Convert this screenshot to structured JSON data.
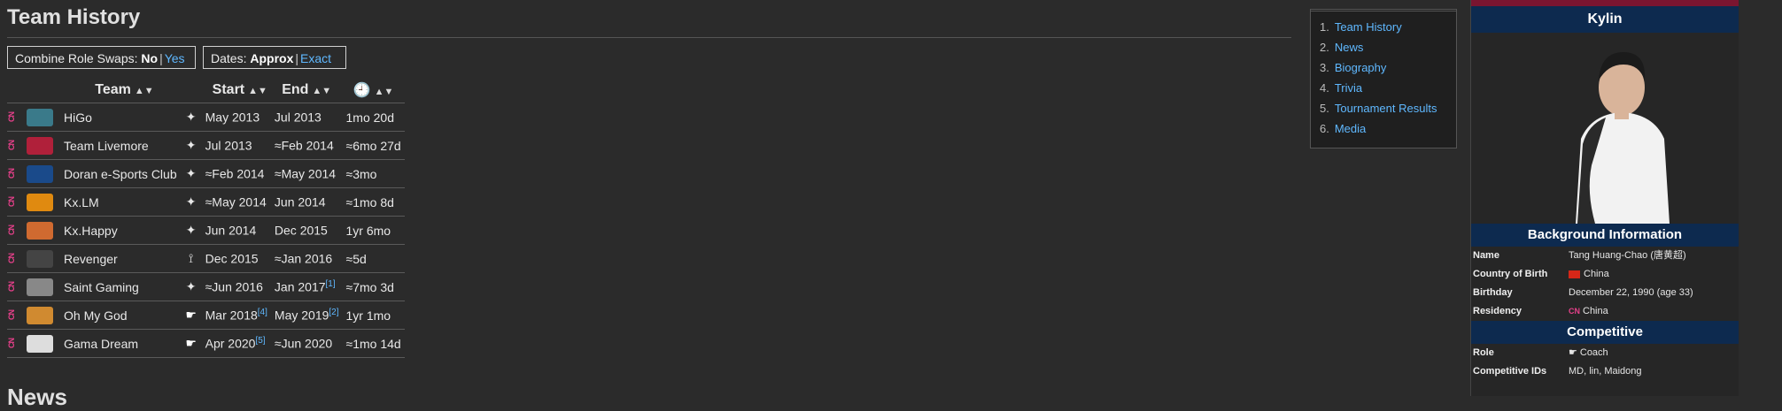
{
  "page": {
    "title": "Team History",
    "next_section_title": "News"
  },
  "toggles": {
    "role_swaps": {
      "label": "Combine Role Swaps:",
      "selected": "No",
      "other": "Yes"
    },
    "dates": {
      "label": "Dates:",
      "selected": "Approx",
      "other": "Exact"
    }
  },
  "table": {
    "headers": {
      "team": "Team",
      "start": "Start",
      "end": "End",
      "clock": "🕘"
    },
    "rows": [
      {
        "country": "CN",
        "team": "HiGo",
        "role": "jungle",
        "start": "May 2013",
        "start_ref": "",
        "end": "Jul 2013",
        "end_ref": "",
        "duration": "1mo 20d",
        "link": false,
        "logo_color": "#3a7a8a"
      },
      {
        "country": "CN",
        "team": "Team Livemore",
        "role": "jungle",
        "start": "Jul 2013",
        "start_ref": "",
        "end": "≈Feb 2014",
        "end_ref": "",
        "duration": "≈6mo 27d",
        "link": true,
        "logo_color": "#b0203a"
      },
      {
        "country": "CN",
        "team": "Doran e-Sports Club",
        "role": "jungle",
        "start": "≈Feb 2014",
        "start_ref": "",
        "end": "≈May 2014",
        "end_ref": "",
        "duration": "≈3mo",
        "link": false,
        "logo_color": "#1a4a8a"
      },
      {
        "country": "CN",
        "team": "Kx.LM",
        "role": "jungle",
        "start": "≈May 2014",
        "start_ref": "",
        "end": "Jun 2014",
        "end_ref": "",
        "duration": "≈1mo 8d",
        "link": false,
        "logo_color": "#e08a10"
      },
      {
        "country": "CN",
        "team": "Kx.Happy",
        "role": "jungle",
        "start": "Jun 2014",
        "start_ref": "",
        "end": "Dec 2015",
        "end_ref": "",
        "duration": "1yr 6mo",
        "link": true,
        "logo_color": "#d06a30"
      },
      {
        "country": "CN",
        "team": "Revenger",
        "role": "other",
        "start": "Dec 2015",
        "start_ref": "",
        "end": "≈Jan 2016",
        "end_ref": "",
        "duration": "≈5d",
        "link": true,
        "logo_color": "#444444"
      },
      {
        "country": "CN",
        "team": "Saint Gaming",
        "role": "jungle",
        "start": "≈Jun 2016",
        "start_ref": "",
        "end": "Jan 2017",
        "end_ref": "[1]",
        "duration": "≈7mo 3d",
        "link": true,
        "logo_color": "#888888"
      },
      {
        "country": "CN",
        "team": "Oh My God",
        "role": "coach",
        "start": "Mar 2018",
        "start_ref": "[4]",
        "end": "May 2019",
        "end_ref": "[2]",
        "duration": "1yr 1mo",
        "link": true,
        "logo_color": "#d08a30"
      },
      {
        "country": "CN",
        "team": "Gama Dream",
        "role": "coach",
        "start": "Apr 2020",
        "start_ref": "[5]",
        "end": "≈Jun 2020",
        "end_ref": "",
        "duration": "≈1mo 14d",
        "link": true,
        "logo_color": "#dddddd"
      }
    ]
  },
  "toc": {
    "items": [
      {
        "num": "1.",
        "label": "Team History"
      },
      {
        "num": "2.",
        "label": "News"
      },
      {
        "num": "3.",
        "label": "Biography"
      },
      {
        "num": "4.",
        "label": "Trivia"
      },
      {
        "num": "5.",
        "label": "Tournament Results"
      },
      {
        "num": "6.",
        "label": "Media"
      }
    ]
  },
  "infobox": {
    "name": "Kylin",
    "section_background": "Background Information",
    "section_competitive": "Competitive",
    "fields": [
      {
        "key": "Name",
        "value": "Tang Huang-Chao (唐黄超)"
      },
      {
        "key": "Country of Birth",
        "value": "China"
      },
      {
        "key": "Birthday",
        "value": "December 22, 1990 (age 33)"
      },
      {
        "key": "Residency",
        "value": "China"
      }
    ],
    "competitive_fields": [
      {
        "key": "Role",
        "value": "Coach"
      },
      {
        "key": "Competitive IDs",
        "value": "MD, lin, Maidong"
      }
    ]
  },
  "colors": {
    "link": "#5fb8ff",
    "header_bg": "#0d2a4f",
    "accent_strip": "#7a1530",
    "country_tag": "#e6408a"
  }
}
